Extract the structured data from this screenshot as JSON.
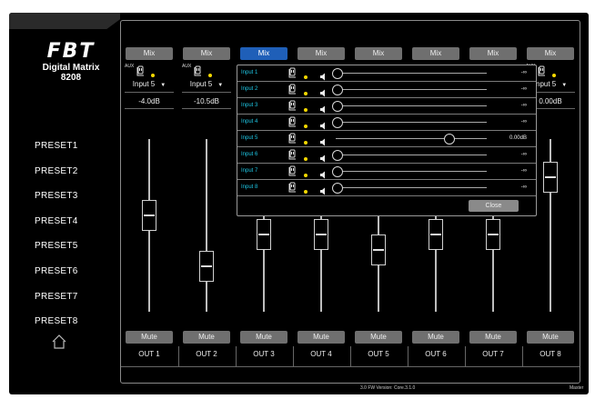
{
  "brand": {
    "logo_text": "FBT",
    "product_line1": "Digital Matrix",
    "product_line2": "8208"
  },
  "presets": [
    "PRESET1",
    "PRESET2",
    "PRESET3",
    "PRESET4",
    "PRESET5",
    "PRESET6",
    "PRESET7",
    "PRESET8"
  ],
  "channels": [
    {
      "mix": "Mix",
      "aux": "AUX",
      "input": "Input 5",
      "gain": "-4.0dB",
      "fader": 0.62,
      "mute": "Mute",
      "out": "OUT 1",
      "active": false
    },
    {
      "mix": "Mix",
      "aux": "AUX",
      "input": "Input 5",
      "gain": "-10.5dB",
      "fader": 0.3,
      "mute": "Mute",
      "out": "OUT 2",
      "active": false
    },
    {
      "mix": "Mix",
      "aux": "",
      "input": "",
      "gain": "",
      "fader": 0.5,
      "mute": "Mute",
      "out": "OUT 3",
      "active": true
    },
    {
      "mix": "Mix",
      "aux": "",
      "input": "",
      "gain": "",
      "fader": 0.5,
      "mute": "Mute",
      "out": "OUT 4",
      "active": false
    },
    {
      "mix": "Mix",
      "aux": "",
      "input": "",
      "gain": "",
      "fader": 0.4,
      "mute": "Mute",
      "out": "OUT 5",
      "active": false
    },
    {
      "mix": "Mix",
      "aux": "",
      "input": "",
      "gain": "",
      "fader": 0.5,
      "mute": "Mute",
      "out": "OUT 6",
      "active": false
    },
    {
      "mix": "Mix",
      "aux": "",
      "input": "",
      "gain": "",
      "fader": 0.5,
      "mute": "Mute",
      "out": "OUT 7",
      "active": false
    },
    {
      "mix": "Mix",
      "aux": "AUX",
      "input": "Input 5",
      "gain": "0.00dB",
      "fader": 0.86,
      "mute": "Mute",
      "out": "OUT 8",
      "active": false
    }
  ],
  "mix_popup": {
    "rows": [
      {
        "name": "Input 1",
        "level": 0.0,
        "value": "-∞"
      },
      {
        "name": "Input 2",
        "level": 0.0,
        "value": "-∞"
      },
      {
        "name": "Input 3",
        "level": 0.0,
        "value": "-∞"
      },
      {
        "name": "Input 4",
        "level": 0.0,
        "value": "-∞"
      },
      {
        "name": "Input 5",
        "level": 0.74,
        "value": "0.00dB"
      },
      {
        "name": "Input 6",
        "level": 0.0,
        "value": "-∞"
      },
      {
        "name": "Input 7",
        "level": 0.0,
        "value": "-∞"
      },
      {
        "name": "Input 8",
        "level": 0.0,
        "value": "-∞"
      }
    ],
    "close_label": "Close"
  },
  "footer": {
    "version": "3.0 FW Version: Core.3.1.0",
    "master": "Master"
  },
  "colors": {
    "accent": "#1f5fb8",
    "input_label": "#1ec8e6",
    "indicator": "#f5d800"
  }
}
